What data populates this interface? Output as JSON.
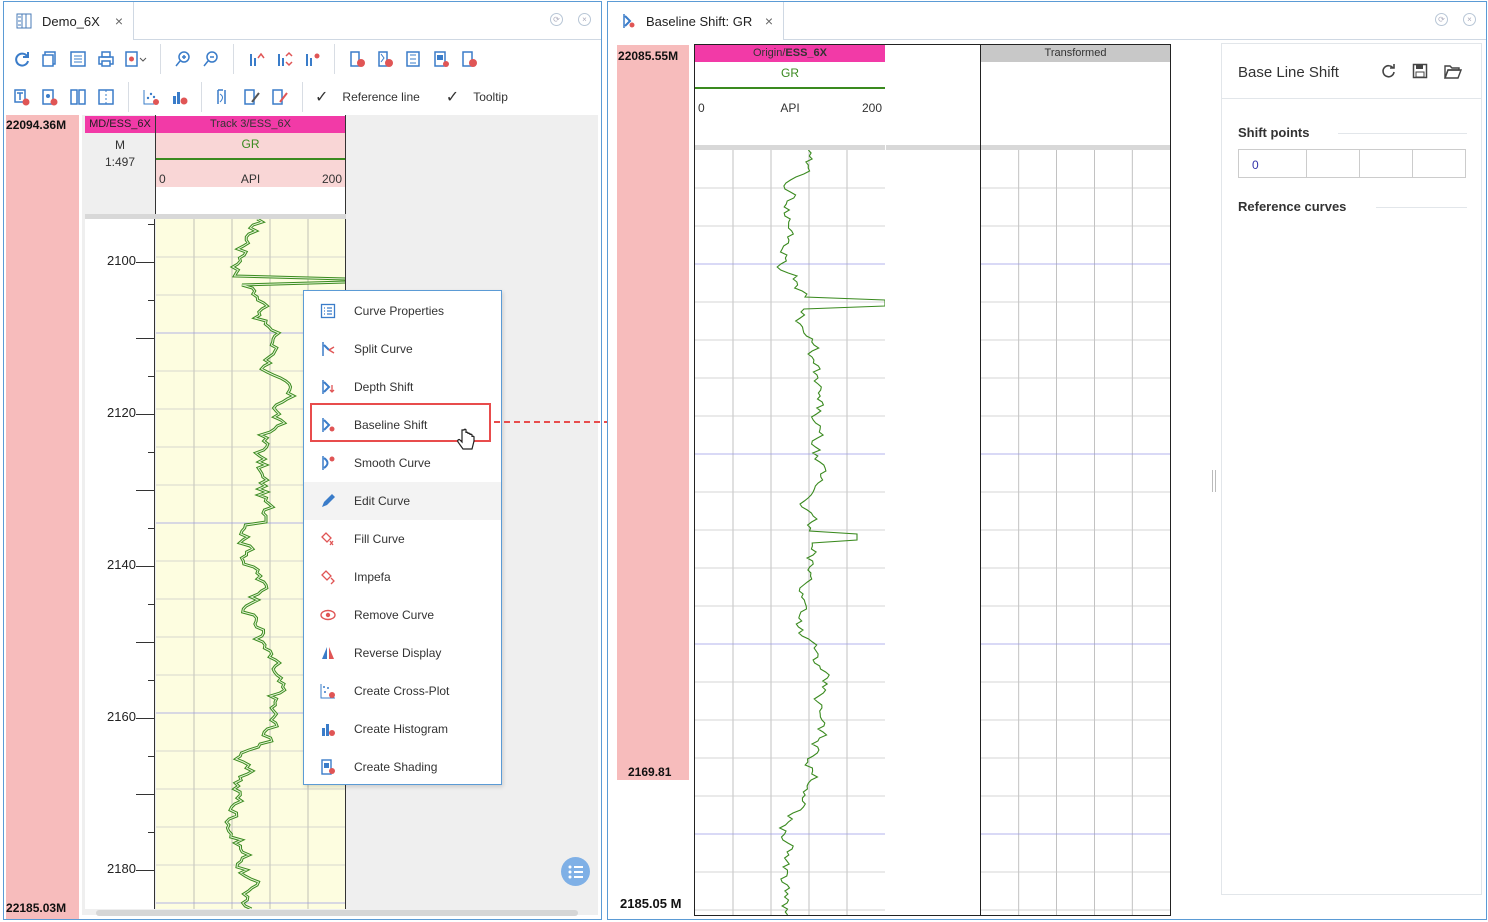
{
  "left_window": {
    "tab_title": "Demo_6X",
    "tab_close": "×",
    "toolbar2": {
      "reference_line": "Reference line",
      "tooltip": "Tooltip"
    },
    "depth_top": "2094.36",
    "depth_top_prefix": "2",
    "depth_top_suffix": "M",
    "depth_bottom": "2185.03",
    "depth_bottom_prefix": "2",
    "depth_bottom_suffix": "M",
    "md_header": "MD/ESS_6X",
    "md_unit": "M",
    "md_scale": "1:497",
    "track_header": "Track 3/ESS_6X",
    "curve_name": "GR",
    "scale_min": "0",
    "scale_unit": "API",
    "scale_max": "200",
    "depth_labels": [
      "2100",
      "2120",
      "2140",
      "2160",
      "2180"
    ]
  },
  "context_menu": {
    "items": [
      {
        "label": "Curve Properties",
        "icon": "list-icon"
      },
      {
        "label": "Split Curve",
        "icon": "split-icon"
      },
      {
        "label": "Depth Shift",
        "icon": "depth-shift-icon"
      },
      {
        "label": "Baseline Shift",
        "icon": "baseline-shift-icon"
      },
      {
        "label": "Smooth Curve",
        "icon": "smooth-icon"
      },
      {
        "label": "Edit Curve",
        "icon": "pencil-icon"
      },
      {
        "label": "Fill Curve",
        "icon": "fill-icon"
      },
      {
        "label": "Impefa",
        "icon": "impefa-icon"
      },
      {
        "label": "Remove Curve",
        "icon": "eye-icon"
      },
      {
        "label": "Reverse Display",
        "icon": "reverse-icon"
      },
      {
        "label": "Create Cross-Plot",
        "icon": "scatter-icon"
      },
      {
        "label": "Create Histogram",
        "icon": "histogram-icon"
      },
      {
        "label": "Create Shading",
        "icon": "shading-icon"
      }
    ],
    "highlighted": "Baseline Shift"
  },
  "right_window": {
    "tab_title": "Baseline Shift: GR",
    "tab_close": "×",
    "depth_top": "2085.55",
    "depth_top_prefix": "2",
    "depth_top_suffix": "M",
    "depth_mid": "2169.81",
    "depth_bottom": "2185.05 M",
    "origin_header_a": "Origin/",
    "origin_header_b": "ESS_6X",
    "curve_name": "GR",
    "scale_min": "0",
    "scale_unit": "API",
    "scale_max": "200",
    "transformed_header": "Transformed"
  },
  "side_panel": {
    "title": "Base Line Shift",
    "shift_points_label": "Shift points",
    "shift_values": [
      "0",
      "",
      "",
      ""
    ],
    "reference_curves_label": "Reference curves"
  },
  "colors": {
    "accent_blue": "#5b9bd5",
    "depth_pink": "#f7bcbc",
    "header_magenta": "#f23aa7",
    "curve_green": "#3a8a1f",
    "highlight_red": "#e84c4c"
  }
}
